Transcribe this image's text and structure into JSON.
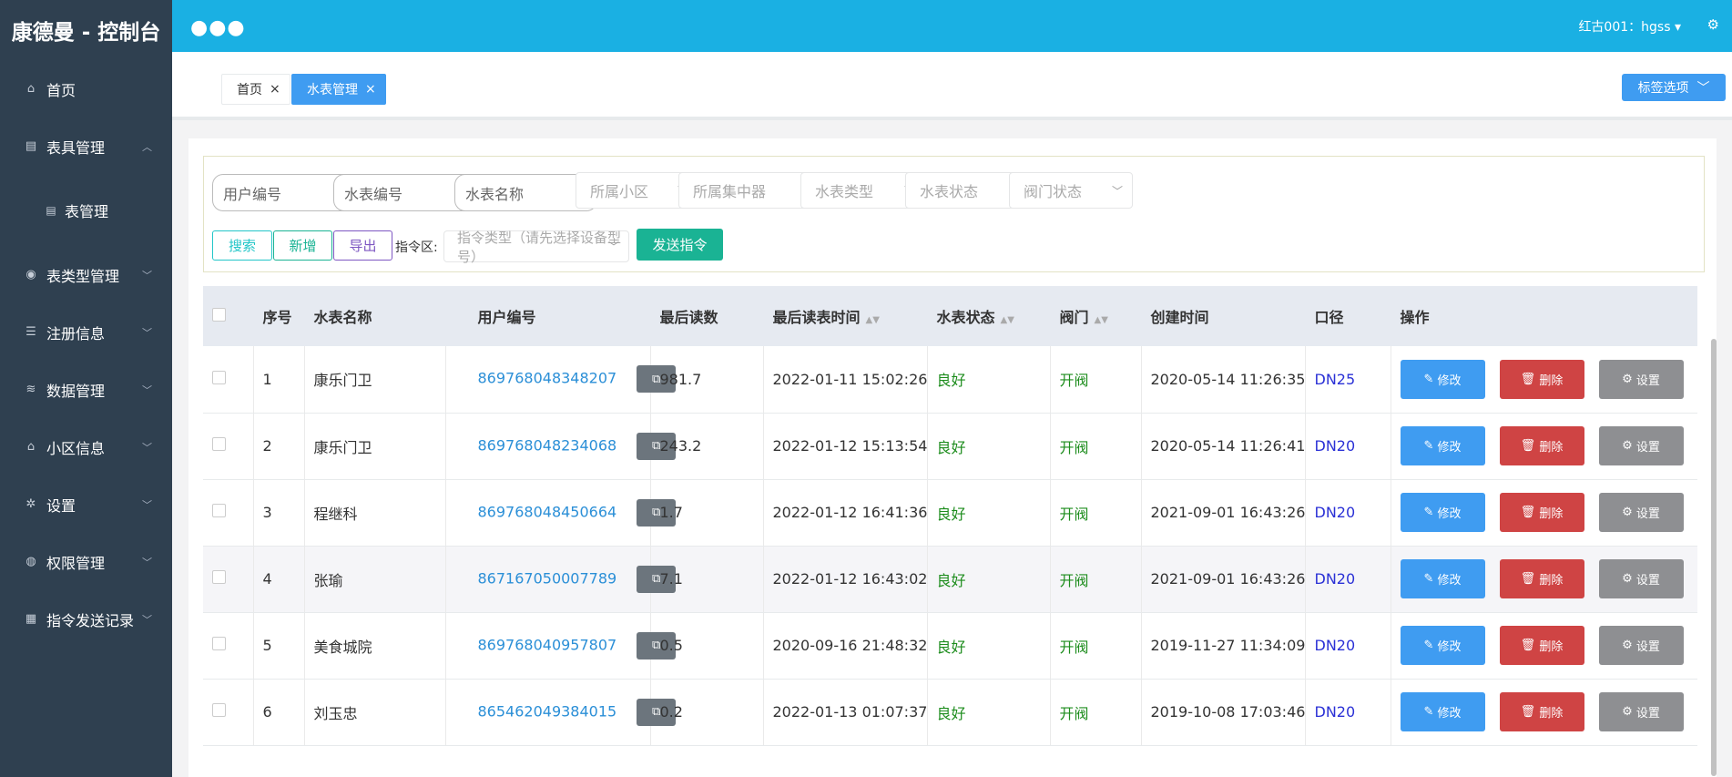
{
  "sidebar": {
    "brand": "康德曼 - 控制台",
    "items": [
      {
        "label": "首页",
        "icon": "home-icon"
      },
      {
        "label": "表具管理",
        "icon": "meter-icon",
        "expanded": true
      },
      {
        "label": "表管理",
        "icon": "meter-icon",
        "sub": true
      },
      {
        "label": "表类型管理",
        "icon": "location-icon"
      },
      {
        "label": "注册信息",
        "icon": "list-icon"
      },
      {
        "label": "数据管理",
        "icon": "database-icon"
      },
      {
        "label": "小区信息",
        "icon": "bank-icon"
      },
      {
        "label": "设置",
        "icon": "gear-icon"
      },
      {
        "label": "权限管理",
        "icon": "user-icon"
      },
      {
        "label": "指令发送记录",
        "icon": "table-icon"
      }
    ]
  },
  "header": {
    "user": "红古001：hgss"
  },
  "tabs": {
    "home": "首页",
    "active": "水表管理",
    "options": "标签选项"
  },
  "filters": {
    "user_no": "用户编号",
    "meter_no": "水表编号",
    "meter_name": "水表名称",
    "community": "所属小区",
    "concentrator": "所属集中器",
    "meter_type": "水表类型",
    "meter_status": "水表状态",
    "valve_status": "阀门状态",
    "search": "搜索",
    "add": "新增",
    "export": "导出",
    "cmd_label": "指令区:",
    "cmd_type": "指令类型（请先选择设备型号）",
    "send": "发送指令"
  },
  "table": {
    "headers": [
      "序号",
      "水表名称",
      "用户编号",
      "最后读数",
      "最后读表时间",
      "水表状态",
      "阀门",
      "创建时间",
      "口径",
      "操作"
    ],
    "actions": {
      "edit": "修改",
      "delete": "删除",
      "settings": "设置"
    },
    "rows": [
      {
        "no": "1",
        "name": "康乐门卫",
        "user": "869768048348207",
        "reading": "981.7",
        "read_time": "2022-01-11 15:02:26",
        "status": "良好",
        "valve": "开阀",
        "created": "2020-05-14 11:26:35",
        "size": "DN25"
      },
      {
        "no": "2",
        "name": "康乐门卫",
        "user": "869768048234068",
        "reading": "243.2",
        "read_time": "2022-01-12 15:13:54",
        "status": "良好",
        "valve": "开阀",
        "created": "2020-05-14 11:26:41",
        "size": "DN20"
      },
      {
        "no": "3",
        "name": "程继科",
        "user": "869768048450664",
        "reading": "1.7",
        "read_time": "2022-01-12 16:41:36",
        "status": "良好",
        "valve": "开阀",
        "created": "2021-09-01 16:43:26",
        "size": "DN20"
      },
      {
        "no": "4",
        "name": "张瑜",
        "user": "867167050007789",
        "reading": "7.1",
        "read_time": "2022-01-12 16:43:02",
        "status": "良好",
        "valve": "开阀",
        "created": "2021-09-01 16:43:26",
        "size": "DN20"
      },
      {
        "no": "5",
        "name": "美食城院",
        "user": "869768040957807",
        "reading": "0.5",
        "read_time": "2020-09-16 21:48:32",
        "status": "良好",
        "valve": "开阀",
        "created": "2019-11-27 11:34:09",
        "size": "DN20"
      },
      {
        "no": "6",
        "name": "刘玉忠",
        "user": "865462049384015",
        "reading": "0.2",
        "read_time": "2022-01-13 01:07:37",
        "status": "良好",
        "valve": "开阀",
        "created": "2019-10-08 17:03:46",
        "size": "DN20"
      }
    ]
  }
}
